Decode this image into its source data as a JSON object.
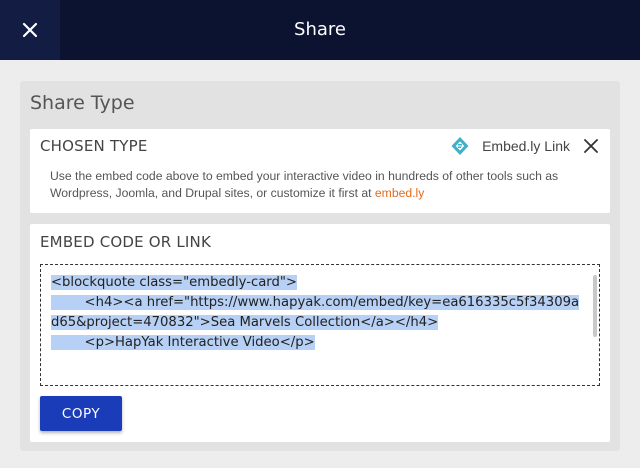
{
  "header": {
    "title": "Share",
    "close_icon": "close-icon"
  },
  "share_type": {
    "title": "Share Type",
    "chosen": {
      "heading": "CHOSEN TYPE",
      "type_label": "Embed.ly Link",
      "type_icon": "embedly-logo-icon",
      "remove_icon": "close-icon",
      "description": "Use the embed code above to embed your interactive video in hundreds of other tools such as Wordpress, Joomla, and Drupal sites, or customize it first at ",
      "link_text": "embed.ly"
    },
    "embed": {
      "heading": "EMBED CODE OR LINK",
      "code_lines": [
        "<blockquote class=\"embedly-card\">",
        "        <h4><a href=\"https://www.hapyak.com/embed/key=ea616335c5f34309ad65&project=470832\">Sea Marvels Collection</a></h4>",
        "        <p>HapYak Interactive Video</p>"
      ],
      "copy_label": "COPY"
    }
  },
  "colors": {
    "header_bg": "#0c1330",
    "close_bg": "#131d44",
    "accent_button": "#1a3cb9",
    "link": "#e56a1c",
    "selection": "#b7d0f5",
    "embedly_icon": "#3fb1c8"
  }
}
